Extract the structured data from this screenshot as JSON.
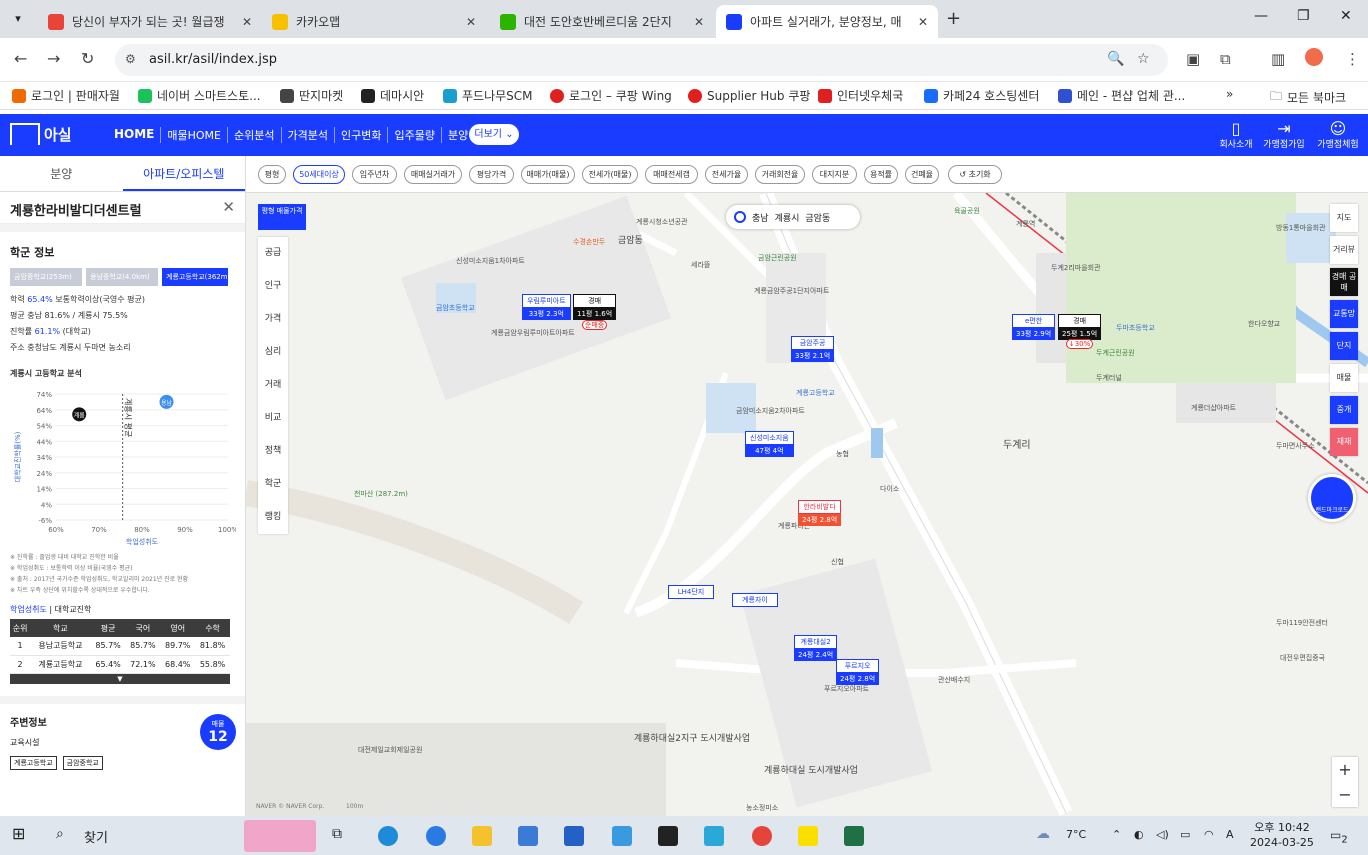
{
  "browser": {
    "tabs": [
      {
        "title": "당신이 부자가 되는 곳! 월급쟁",
        "color": "#e8443a"
      },
      {
        "title": "카카오맵",
        "color": "#f5c100"
      },
      {
        "title": "대전 도안호반베르디움 2단지",
        "color": "#2db400"
      },
      {
        "title": "아파트 실거래가, 분양정보, 매",
        "color": "#1a3cff"
      }
    ],
    "url": "asil.kr/asil/index.jsp",
    "bookmarks": [
      {
        "label": "로그인 | 판매자월",
        "color": "#f06a00"
      },
      {
        "label": "네이버 스마트스토...",
        "color": "#19c35a"
      },
      {
        "label": "딴지마켓",
        "color": "#444"
      },
      {
        "label": "데마시안",
        "color": "#222"
      },
      {
        "label": "푸드나무SCM",
        "color": "#1a9ecf"
      },
      {
        "label": "로그인 – 쿠팡 Wing",
        "color": "#e02020"
      },
      {
        "label": "Supplier Hub 쿠팡",
        "color": "#e02020"
      },
      {
        "label": "인터넷우체국",
        "color": "#e02020"
      },
      {
        "label": "카페24 호스팅센터",
        "color": "#1a6cff"
      },
      {
        "label": "메인 - 편샵 업체 관...",
        "color": "#3050d0"
      }
    ],
    "all_bookmarks": "모든 북마크"
  },
  "site": {
    "logo": "아실",
    "nav": [
      "HOME",
      "매물HOME",
      "순위분석",
      "가격분석",
      "인구변화",
      "입주물량",
      "분양"
    ],
    "more": "더보기",
    "right": [
      "회사소개",
      "가맹점가입",
      "가맹점체험"
    ]
  },
  "panel": {
    "tabs": [
      "분양",
      "아파트/오피스텔"
    ],
    "title": "계룡한라비발디더센트럴",
    "school_heading": "학군 정보",
    "schools": [
      "금암중학교(253m)",
      "용남중학교(4.0km)",
      "계룡고등학교(362m)"
    ],
    "stats": [
      {
        "label": "학력",
        "value": "65.4%",
        "rest": "보통학력이상(국영수 평균)"
      },
      {
        "label": "평균 충남 81.6% / 계룡시 75.5%",
        "value": "",
        "rest": ""
      },
      {
        "label": "진학률",
        "value": "61.1%",
        "rest": "(대학교)"
      },
      {
        "label": "주소 충청남도 계룡시 두마면 농소리",
        "value": "",
        "rest": ""
      }
    ],
    "analysis_heading": "계룡시 고등학교 분석",
    "notes": [
      "※ 진학률 : 졸업생 대비 대학교 진학한 비율",
      "※ 학업성취도 : 보통학력 이상 비율(국영수 평균)",
      "※ 출처 : 2017년 국가수준 학업성취도, 학교알리미 2021년 진로 현황",
      "※ 차트 우측 상단에 위치할수록 상대적으로 우수합니다."
    ],
    "subtabs": [
      "학업성취도",
      "대학교진학"
    ],
    "table": {
      "headers": [
        "순위",
        "학교",
        "평균",
        "국어",
        "영어",
        "수학"
      ],
      "rows": [
        [
          "1",
          "용남고등학교",
          "85.7%",
          "85.7%",
          "89.7%",
          "81.8%"
        ],
        [
          "2",
          "계룡고등학교",
          "65.4%",
          "72.1%",
          "68.4%",
          "55.8%"
        ]
      ]
    },
    "near_heading": "주변정보",
    "edu": "교육시설",
    "tags": [
      "계룡고등학교",
      "금암중학교"
    ],
    "count_label": "매물",
    "count": "12"
  },
  "chart_data": {
    "type": "scatter",
    "xlabel": "학업성취도",
    "ylabel": "대학교진학률(%)",
    "x_ticks": [
      "60%",
      "70%",
      "80%",
      "90%",
      "100%"
    ],
    "y_ticks": [
      "74%",
      "64%",
      "54%",
      "44%",
      "34%",
      "24%",
      "14%",
      "4%",
      "-6%"
    ],
    "xlim": [
      60,
      100
    ],
    "ylim": [
      -6,
      74
    ],
    "ref_line_label": "계룡시 평균",
    "ref_line_x": 75.5,
    "points": [
      {
        "label": "계룡",
        "x": 65.4,
        "y": 61.1,
        "color": "#111111"
      },
      {
        "label": "용남",
        "x": 85.7,
        "y": 69,
        "color": "#3a8ef0"
      }
    ]
  },
  "filters": [
    "평형",
    "50세대이상",
    "입주년차",
    "매매실거래가",
    "평당가격",
    "매매가(매물)",
    "전세가(매물)",
    "매매전세갭",
    "전세가율",
    "거래회전율",
    "대지지분",
    "용적률",
    "건폐율",
    "초기화"
  ],
  "map": {
    "left_menu_top": "평형 매물가격",
    "left_menu": [
      "공급",
      "인구",
      "가격",
      "심리",
      "거래",
      "비교",
      "정책",
      "학군",
      "랭킹"
    ],
    "location": [
      "충남",
      "계룡시",
      "금암동"
    ],
    "markers": [
      {
        "name": "우림루미아트",
        "price": "33평 2.3억",
        "style": "blue"
      },
      {
        "name": "경매",
        "price": "11평 1.6억",
        "change": "순매중",
        "style": "dark"
      },
      {
        "name": "금암주공",
        "price": "33평 2.1억",
        "style": "blue"
      },
      {
        "name": "신성미소지움",
        "price": "47평 4억",
        "style": "blue"
      },
      {
        "name": "한라비발디",
        "price": "24평 2.8억",
        "style": "red"
      },
      {
        "name": "LH4단지",
        "price": "",
        "style": "blue"
      },
      {
        "name": "계룡자이",
        "price": "",
        "style": "blue"
      },
      {
        "name": "계룡대실2",
        "price": "24평 2.4억",
        "style": "blue"
      },
      {
        "name": "푸르지오",
        "price": "24평 2.8억",
        "style": "blue"
      },
      {
        "name": "e편한",
        "price": "33평 2.9억",
        "style": "blue"
      },
      {
        "name": "경매",
        "price": "25평 1.5억",
        "change": "↓30%",
        "style": "dark"
      }
    ],
    "places": [
      "신성미소지움1차아파트",
      "계룡금암우림루미아트아파트",
      "금암초등학교",
      "수경손만두",
      "금암동",
      "계룡시청소년공관",
      "금암근린공원",
      "계룡금암주공1단지아파트",
      "세라뜰",
      "금암미소지움2차아파트",
      "계룡고등학교",
      "천마산 (287.2m)",
      "농협",
      "다이소",
      "신협",
      "두계2리마을회관",
      "두마초등학교",
      "두계근린공원",
      "계룡더샵아파트",
      "두마119안전센터",
      "대전우편집중국",
      "관산배수지",
      "대전제일교회제일공원",
      "방동1통마을회관",
      "계룡역",
      "육골공원",
      "한다오향교",
      "두마면사무소",
      "두계터널",
      "푸르지오아파트",
      "농소정미소",
      "계룡파라곤"
    ],
    "big_labels": [
      "두계리",
      "계룡하대실2지구 도시개발사업",
      "계룡하대실 도시개발사업"
    ],
    "right_tools": [
      "지도",
      "거리뷰",
      "경매 공매",
      "교통망",
      "단지",
      "매물",
      "중개",
      "재재"
    ],
    "round_button": "랜드마크로드",
    "credit": "NAVER © NAVER Corp.",
    "scale": "100m"
  },
  "taskbar": {
    "search": "찾기",
    "weather": "7°C",
    "ime": "A",
    "time": "오후 10:42",
    "date": "2024-03-25",
    "notif": "2"
  }
}
